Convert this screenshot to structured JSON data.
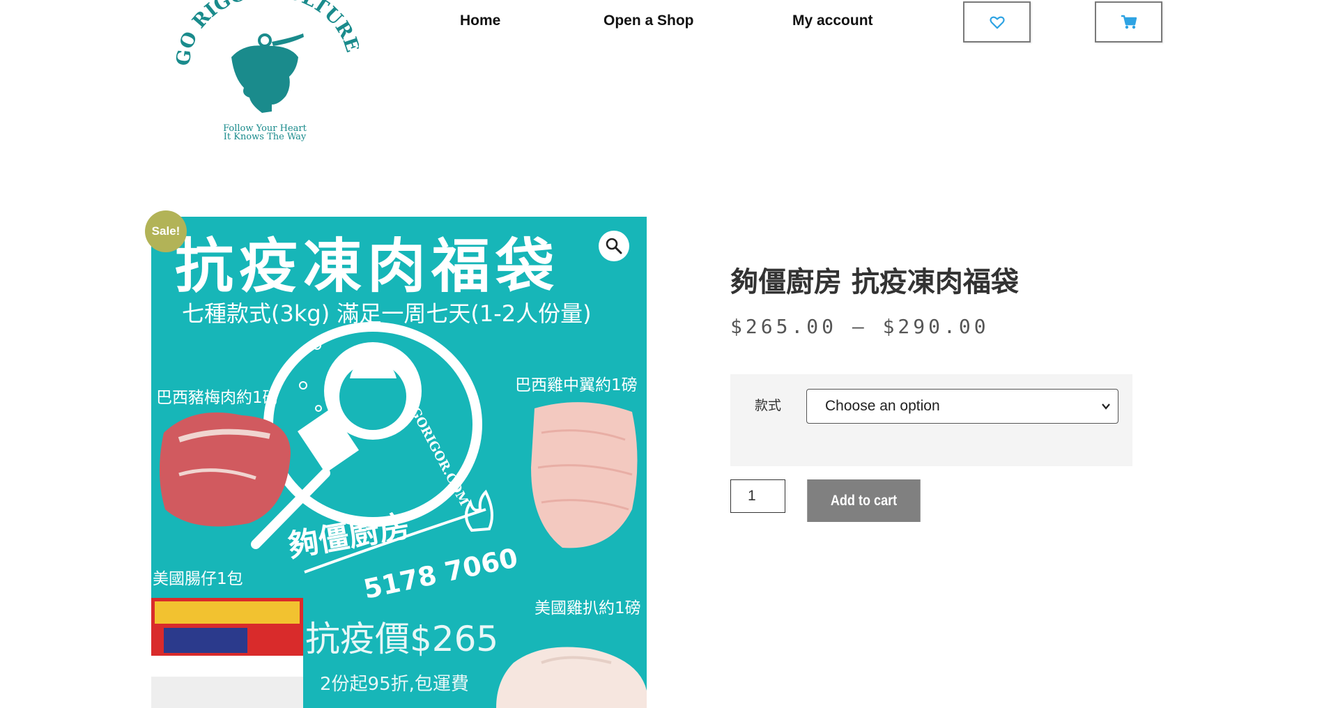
{
  "header": {
    "logo": {
      "brand": "GO RIGOR CULTURE",
      "tagline_1": "Follow Your Heart",
      "tagline_2": "It Knows The Way"
    },
    "nav": [
      {
        "label": "Home"
      },
      {
        "label": "Open a Shop"
      },
      {
        "label": "My account"
      }
    ],
    "wishlist_icon": "heart-icon",
    "cart_icon": "cart-icon"
  },
  "product": {
    "sale_badge": "Sale!",
    "zoom_icon": "magnifier-icon",
    "image": {
      "title": "抗疫凍肉福袋",
      "subtitle": "七種款式(3kg) 滿足一周七天(1-2人份量)",
      "item_pork": "巴西豬梅肉約1磅",
      "item_wings": "巴西雞中翼約1磅",
      "item_sausage": "美國腸仔1包",
      "item_thigh": "美國雞扒約1磅",
      "brand": "夠僵廚房",
      "phone": "5178 7060",
      "url": "GORIGOR.COM",
      "promo_price": "抗疫價$265",
      "discount": "2份起95折,包運費"
    },
    "title": "夠僵廚房 抗疫凍肉福袋",
    "price_range": "$265.00 – $290.00",
    "variation_label": "款式",
    "variation_selected": "Choose an option",
    "quantity": "1",
    "add_to_cart": "Add to cart"
  },
  "colors": {
    "brand_teal": "#1a8b8c",
    "image_bg": "#17b6b8",
    "sale_badge": "#b2b357",
    "button": "#808080",
    "icon_blue": "#2ea3e3"
  }
}
